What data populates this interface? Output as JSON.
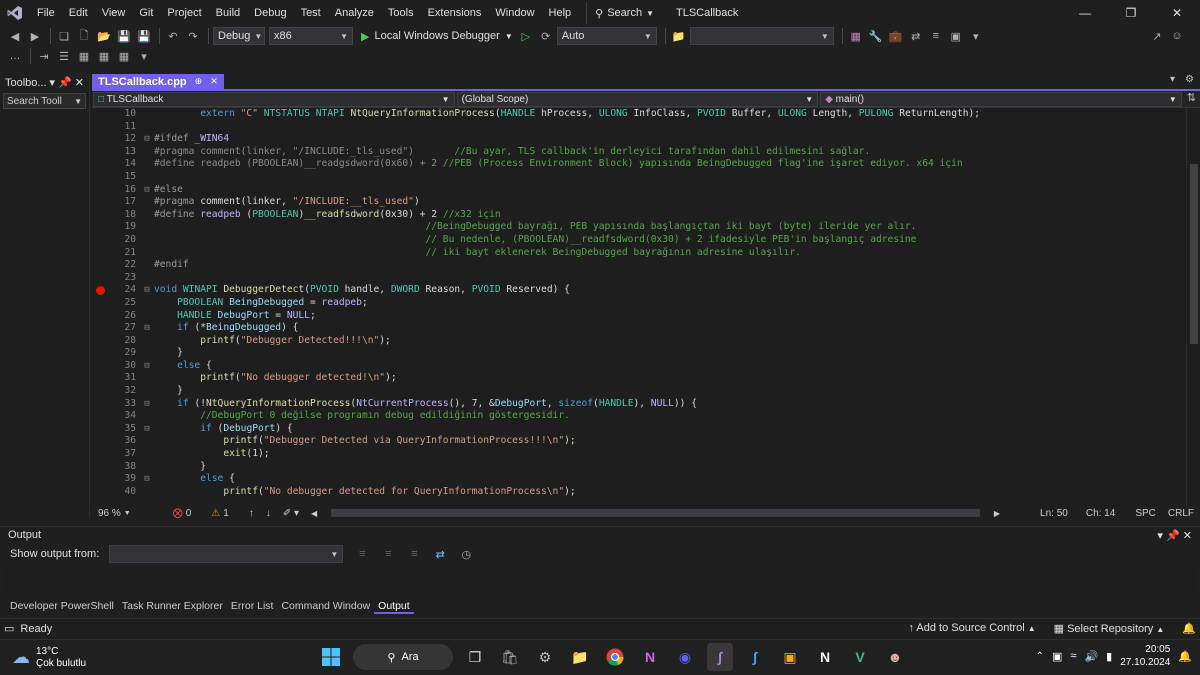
{
  "menubar": {
    "items": [
      "File",
      "Edit",
      "View",
      "Git",
      "Project",
      "Build",
      "Debug",
      "Test",
      "Analyze",
      "Tools",
      "Extensions",
      "Window",
      "Help"
    ],
    "search_label": "Search",
    "solution_name": "TLSCallback"
  },
  "toolbar": {
    "config": "Debug",
    "platform": "x86",
    "run_label": "Local Windows Debugger",
    "mode": "Auto"
  },
  "toolbox": {
    "title": "Toolbo...",
    "search_placeholder": "Search Tooll"
  },
  "editor": {
    "tab_label": "TLSCallback.cpp",
    "nav_project": "TLSCallback",
    "nav_scope": "(Global Scope)",
    "nav_member": "main()",
    "lines": [
      {
        "num": "10",
        "indent": 2,
        "segments": [
          [
            "kw",
            "extern "
          ],
          [
            "str",
            "\"C\""
          ],
          [
            "plain",
            " "
          ],
          [
            "type",
            "NTSTATUS"
          ],
          [
            "plain",
            " "
          ],
          [
            "type",
            "NTAPI"
          ],
          [
            "plain",
            " "
          ],
          [
            "fn",
            "NtQueryInformationProcess"
          ],
          [
            "plain",
            "("
          ],
          [
            "type",
            "HANDLE"
          ],
          [
            "plain",
            " hProcess, "
          ],
          [
            "type",
            "ULONG"
          ],
          [
            "plain",
            " InfoClass, "
          ],
          [
            "type",
            "PVOID"
          ],
          [
            "plain",
            " Buffer, "
          ],
          [
            "type",
            "ULONG"
          ],
          [
            "plain",
            " Length, "
          ],
          [
            "type",
            "PULONG"
          ],
          [
            "plain",
            " ReturnLength);"
          ]
        ]
      },
      {
        "num": "11",
        "indent": 0,
        "segments": []
      },
      {
        "num": "12",
        "indent": 0,
        "fold": "⊟",
        "segments": [
          [
            "pp",
            "#ifdef "
          ],
          [
            "macro",
            "_WIN64"
          ]
        ]
      },
      {
        "num": "13",
        "indent": 0,
        "segments": [
          [
            "dim",
            "#pragma comment(linker, \"/INCLUDE:_tls_used\")       "
          ],
          [
            "cmt",
            "//Bu ayar, TLS callback'in derleyici tarafından dahil edilmesini sağlar."
          ]
        ]
      },
      {
        "num": "14",
        "indent": 0,
        "segments": [
          [
            "dim",
            "#define readpeb (PBOOLEAN)__readgsdword(0x60) + 2 "
          ],
          [
            "cmt",
            "//PEB (Process Environment Block) yapısında BeingDebugged flag'ine işaret ediyor. x64 için"
          ]
        ]
      },
      {
        "num": "15",
        "indent": 0,
        "segments": []
      },
      {
        "num": "16",
        "indent": 0,
        "fold": "⊟",
        "segments": [
          [
            "pp",
            "#else"
          ]
        ]
      },
      {
        "num": "17",
        "indent": 0,
        "segments": [
          [
            "pp",
            "#pragma "
          ],
          [
            "plain",
            "comment(linker, "
          ],
          [
            "str",
            "\"/INCLUDE:__tls_used\""
          ],
          [
            "plain",
            ")"
          ]
        ]
      },
      {
        "num": "18",
        "indent": 0,
        "segments": [
          [
            "pp",
            "#define "
          ],
          [
            "macro",
            "readpeb"
          ],
          [
            "plain",
            " ("
          ],
          [
            "type",
            "PBOOLEAN"
          ],
          [
            "plain",
            ")"
          ],
          [
            "fn",
            "__readfsdword"
          ],
          [
            "plain",
            "(0x30) + 2 "
          ],
          [
            "cmt",
            "//x32 için"
          ]
        ]
      },
      {
        "num": "19",
        "indent": 0,
        "segments": [
          [
            "plain",
            "                                               "
          ],
          [
            "cmt",
            "//BeingDebugged bayrağı, PEB yapısında başlangıçtan iki bayt (byte) ileride yer alır."
          ]
        ]
      },
      {
        "num": "20",
        "indent": 0,
        "segments": [
          [
            "plain",
            "                                               "
          ],
          [
            "cmt",
            "// Bu nedenle, (PBOOLEAN)__readfsdword(0x30) + 2 ifadesiyle PEB'in başlangıç adresine"
          ]
        ]
      },
      {
        "num": "21",
        "indent": 0,
        "segments": [
          [
            "plain",
            "                                               "
          ],
          [
            "cmt",
            "// iki bayt eklenerek BeingDebugged bayrağının adresine ulaşılır."
          ]
        ]
      },
      {
        "num": "22",
        "indent": 0,
        "segments": [
          [
            "pp",
            "#endif"
          ]
        ]
      },
      {
        "num": "23",
        "indent": 0,
        "segments": []
      },
      {
        "num": "24",
        "indent": 0,
        "fold": "⊟",
        "bp": true,
        "segments": [
          [
            "kw",
            "void "
          ],
          [
            "type",
            "WINAPI"
          ],
          [
            "plain",
            " "
          ],
          [
            "fn",
            "DebuggerDetect"
          ],
          [
            "plain",
            "("
          ],
          [
            "type",
            "PVOID"
          ],
          [
            "plain",
            " handle, "
          ],
          [
            "type",
            "DWORD"
          ],
          [
            "plain",
            " Reason, "
          ],
          [
            "type",
            "PVOID"
          ],
          [
            "plain",
            " Reserved) {"
          ]
        ]
      },
      {
        "num": "25",
        "indent": 1,
        "segments": [
          [
            "type",
            "PBOOLEAN"
          ],
          [
            "plain",
            " "
          ],
          [
            "var",
            "BeingDebugged"
          ],
          [
            "plain",
            " = "
          ],
          [
            "macro",
            "readpeb"
          ],
          [
            "plain",
            ";"
          ]
        ]
      },
      {
        "num": "26",
        "indent": 1,
        "segments": [
          [
            "type",
            "HANDLE"
          ],
          [
            "plain",
            " "
          ],
          [
            "var",
            "DebugPort"
          ],
          [
            "plain",
            " = "
          ],
          [
            "macro",
            "NULL"
          ],
          [
            "plain",
            ";"
          ]
        ]
      },
      {
        "num": "27",
        "indent": 1,
        "fold": "⊟",
        "segments": [
          [
            "kw",
            "if"
          ],
          [
            "plain",
            " (*"
          ],
          [
            "var",
            "BeingDebugged"
          ],
          [
            "plain",
            ") {"
          ]
        ]
      },
      {
        "num": "28",
        "indent": 2,
        "segments": [
          [
            "fn",
            "printf"
          ],
          [
            "plain",
            "("
          ],
          [
            "str",
            "\"Debugger Detected!!!\\n\""
          ],
          [
            "plain",
            ");"
          ]
        ]
      },
      {
        "num": "29",
        "indent": 1,
        "segments": [
          [
            "plain",
            "}"
          ]
        ]
      },
      {
        "num": "30",
        "indent": 1,
        "fold": "⊟",
        "segments": [
          [
            "kw",
            "else"
          ],
          [
            "plain",
            " {"
          ]
        ]
      },
      {
        "num": "31",
        "indent": 2,
        "segments": [
          [
            "fn",
            "printf"
          ],
          [
            "plain",
            "("
          ],
          [
            "str",
            "\"No debugger detected!\\n\""
          ],
          [
            "plain",
            ");"
          ]
        ]
      },
      {
        "num": "32",
        "indent": 1,
        "segments": [
          [
            "plain",
            "}"
          ]
        ]
      },
      {
        "num": "33",
        "indent": 1,
        "fold": "⊟",
        "segments": [
          [
            "kw",
            "if"
          ],
          [
            "plain",
            " (!"
          ],
          [
            "fn",
            "NtQueryInformationProcess"
          ],
          [
            "plain",
            "("
          ],
          [
            "macro",
            "NtCurrentProcess"
          ],
          [
            "plain",
            "(), 7, &"
          ],
          [
            "var",
            "DebugPort"
          ],
          [
            "plain",
            ", "
          ],
          [
            "kw",
            "sizeof"
          ],
          [
            "plain",
            "("
          ],
          [
            "type",
            "HANDLE"
          ],
          [
            "plain",
            "), "
          ],
          [
            "macro",
            "NULL"
          ],
          [
            "plain",
            ")) {"
          ]
        ]
      },
      {
        "num": "34",
        "indent": 2,
        "segments": [
          [
            "cmt",
            "//DebugPort 0 değilse programın debug edildiğinin göstergesidir."
          ]
        ]
      },
      {
        "num": "35",
        "indent": 2,
        "fold": "⊟",
        "segments": [
          [
            "kw",
            "if"
          ],
          [
            "plain",
            " ("
          ],
          [
            "var",
            "DebugPort"
          ],
          [
            "plain",
            ") {"
          ]
        ]
      },
      {
        "num": "36",
        "indent": 3,
        "segments": [
          [
            "fn",
            "printf"
          ],
          [
            "plain",
            "("
          ],
          [
            "str",
            "\"Debugger Detected via QueryInformationProcess!!!\\n\""
          ],
          [
            "plain",
            ");"
          ]
        ]
      },
      {
        "num": "37",
        "indent": 3,
        "segments": [
          [
            "fn",
            "exit"
          ],
          [
            "plain",
            "(1);"
          ]
        ]
      },
      {
        "num": "38",
        "indent": 2,
        "segments": [
          [
            "plain",
            "}"
          ]
        ]
      },
      {
        "num": "39",
        "indent": 2,
        "fold": "⊟",
        "segments": [
          [
            "kw",
            "else"
          ],
          [
            "plain",
            " {"
          ]
        ]
      },
      {
        "num": "40",
        "indent": 3,
        "segments": [
          [
            "fn",
            "printf"
          ],
          [
            "plain",
            "("
          ],
          [
            "str",
            "\"No debugger detected for QueryInformationProcess\\n\""
          ],
          [
            "plain",
            ");"
          ]
        ]
      }
    ],
    "colors": {
      "kw": "#569cd6",
      "type": "#4ec9b0",
      "fn": "#dcdcaa",
      "str": "#d69d85",
      "cmt": "#57a64a",
      "pp": "#9b9b9b",
      "macro": "#beb7ff",
      "var": "#9cdcfe",
      "plain": "#dcdcdc",
      "dim": "#8c8c8c"
    },
    "status": {
      "zoom": "96 %",
      "errors": "0",
      "warnings": "1",
      "line": "Ln: 50",
      "col": "Ch: 14",
      "spacing": "SPC",
      "eol": "CRLF"
    }
  },
  "output": {
    "title": "Output",
    "show_from_label": "Show output from:"
  },
  "bottom_tabs": [
    "Developer PowerShell",
    "Task Runner Explorer",
    "Error List",
    "Command Window",
    "Output"
  ],
  "statusbar": {
    "ready": "Ready",
    "source_control": "Add to Source Control",
    "repository": "Select Repository"
  },
  "taskbar": {
    "temperature": "13°C",
    "weather": "Çok bulutlu",
    "search_label": "Ara",
    "time": "20:05",
    "date": "27.10.2024"
  }
}
